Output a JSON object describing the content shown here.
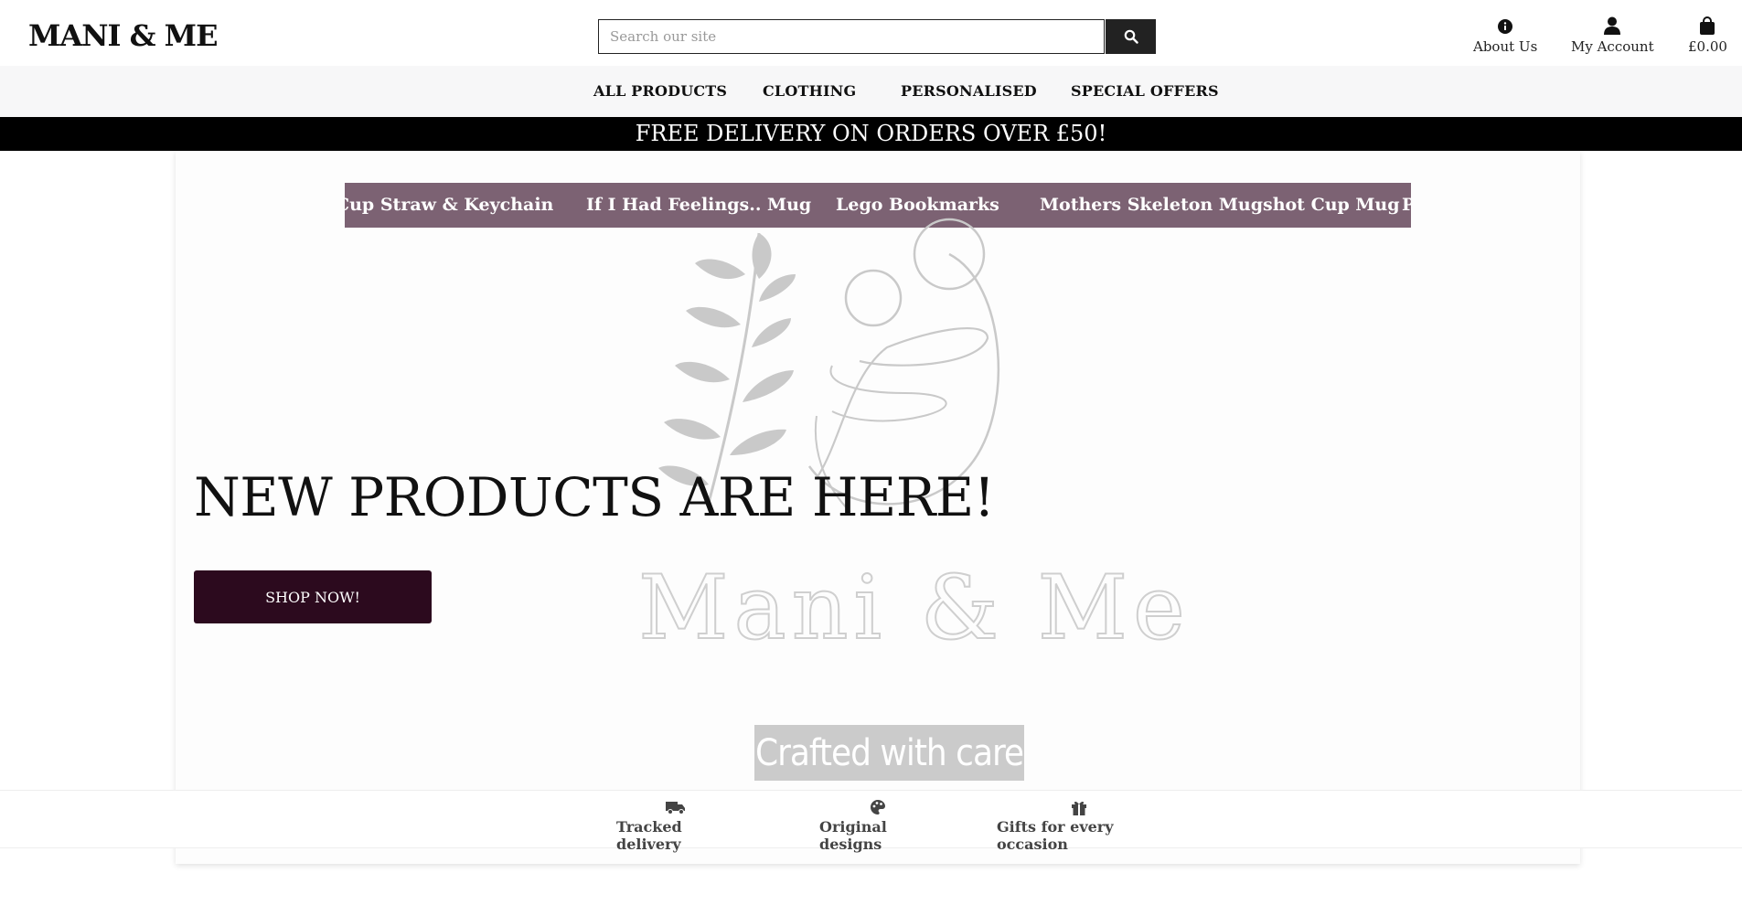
{
  "header": {
    "logo": "MANI & ME",
    "search": {
      "placeholder": "Search our site",
      "button_icon": "search-icon"
    },
    "links": [
      {
        "label": "About Us",
        "icon": "info-icon"
      },
      {
        "label": "My Account",
        "icon": "user-icon"
      },
      {
        "label": "£0.00",
        "icon": "shopping-bag-icon"
      }
    ]
  },
  "nav": {
    "items": [
      "ALL PRODUCTS",
      "CLOTHING",
      "PERSONALISED",
      "SPECIAL OFFERS"
    ]
  },
  "banner": {
    "text": "FREE DELIVERY ON ORDERS OVER £50!"
  },
  "ticker": {
    "items": [
      "Cup Straw & Keychain",
      "If I Had Feelings.. Mug",
      "Lego Bookmarks",
      "Mothers Skeleton Mugshot Cup Mug",
      "P"
    ]
  },
  "hero": {
    "watermark_text": "Mani & Me",
    "title": "NEW PRODUCTS ARE HERE!",
    "button": "SHOP NOW!",
    "crafted_label": "Crafted with care"
  },
  "features": [
    {
      "label": "Tracked delivery",
      "icon": "truck-icon"
    },
    {
      "label": "Original designs",
      "icon": "palette-icon"
    },
    {
      "label": "Gifts for every occasion",
      "icon": "gift-icon"
    }
  ],
  "colors": {
    "ticker_bg": "#7c6273",
    "button_bg": "#2c0a1e",
    "banner_bg": "#000000"
  }
}
